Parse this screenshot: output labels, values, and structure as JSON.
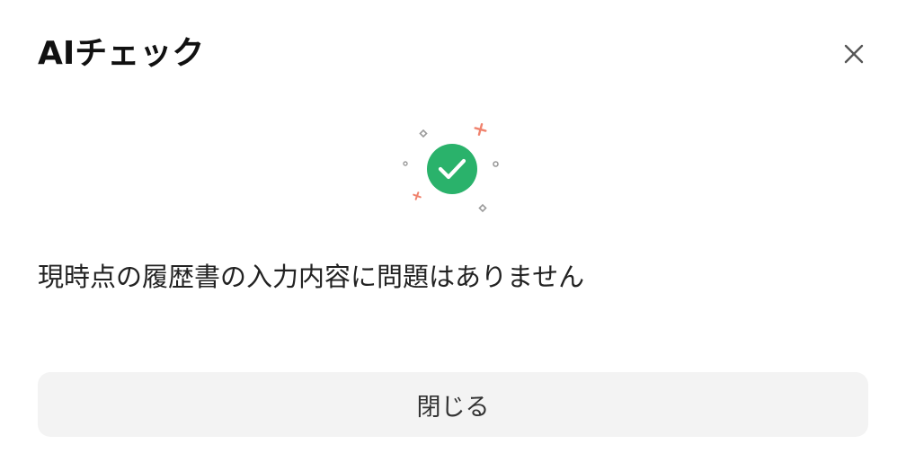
{
  "dialog": {
    "title": "AIチェック",
    "message": "現時点の履歴書の入力内容に問題はありません",
    "close_button_label": "閉じる",
    "icons": {
      "close": "close-icon",
      "success": "check-circle-icon"
    },
    "colors": {
      "success": "#2ab26b",
      "sparkle_accent": "#f0836e",
      "sparkle_neutral": "#9a9a9a",
      "button_bg": "#f3f3f3"
    }
  }
}
